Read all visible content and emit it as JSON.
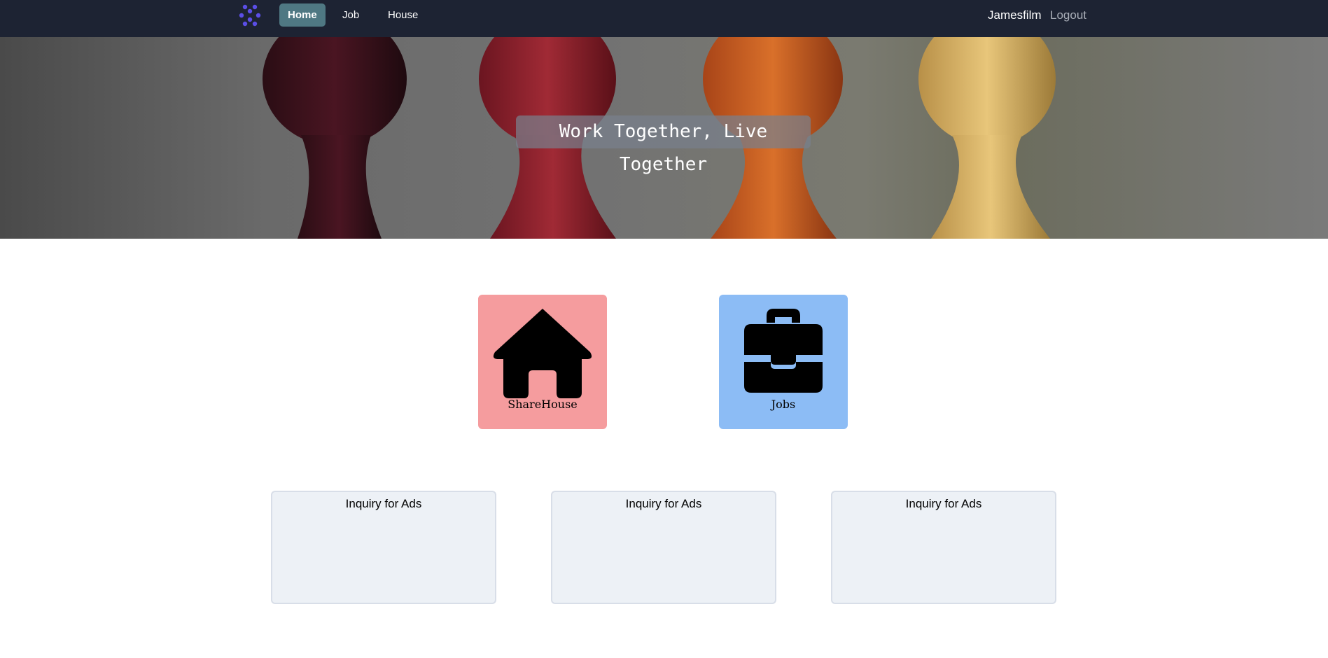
{
  "nav": {
    "links": [
      {
        "label": "Home",
        "active": true
      },
      {
        "label": "Job",
        "active": false
      },
      {
        "label": "House",
        "active": false
      }
    ],
    "username": "Jamesfilm",
    "logout_label": "Logout",
    "logo_icon": "dots-cross-logo-icon"
  },
  "hero": {
    "title": "Work Together, Live Together"
  },
  "tiles": [
    {
      "label": "ShareHouse",
      "icon": "house-icon",
      "color": "#f59c9e"
    },
    {
      "label": "Jobs",
      "icon": "briefcase-icon",
      "color": "#8cbcf5"
    }
  ],
  "ads": [
    {
      "label": "Inquiry for Ads"
    },
    {
      "label": "Inquiry for Ads"
    },
    {
      "label": "Inquiry for Ads"
    }
  ]
}
